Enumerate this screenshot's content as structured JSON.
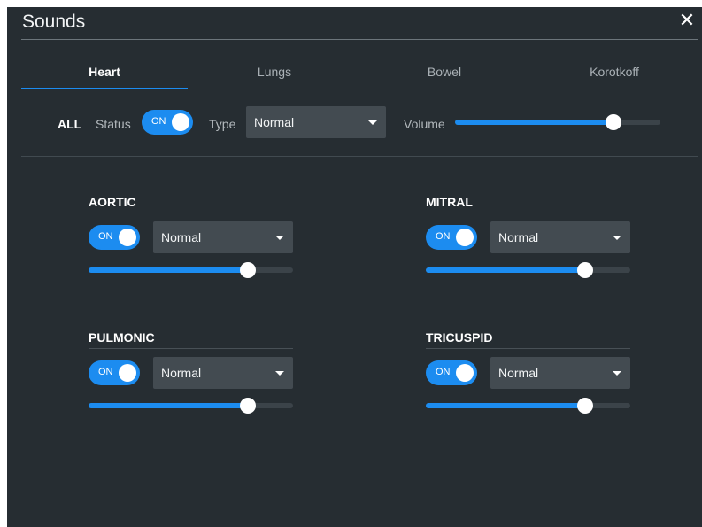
{
  "dialog": {
    "title": "Sounds",
    "close_icon": "close-icon"
  },
  "tabs": [
    {
      "label": "Heart",
      "active": true
    },
    {
      "label": "Lungs",
      "active": false
    },
    {
      "label": "Bowel",
      "active": false
    },
    {
      "label": "Korotkoff",
      "active": false
    }
  ],
  "all": {
    "label": "ALL",
    "status_label": "Status",
    "status_toggle": "ON",
    "type_label": "Type",
    "type_value": "Normal",
    "volume_label": "Volume",
    "volume_level": 0.77
  },
  "sections": [
    {
      "name": "AORTIC",
      "toggle": "ON",
      "type_value": "Normal",
      "volume_level": 0.78
    },
    {
      "name": "MITRAL",
      "toggle": "ON",
      "type_value": "Normal",
      "volume_level": 0.78
    },
    {
      "name": "PULMONIC",
      "toggle": "ON",
      "type_value": "Normal",
      "volume_level": 0.78
    },
    {
      "name": "TRICUSPID",
      "toggle": "ON",
      "type_value": "Normal",
      "volume_level": 0.78
    }
  ],
  "colors": {
    "accent": "#1c8cf0",
    "panel": "#262d32"
  }
}
